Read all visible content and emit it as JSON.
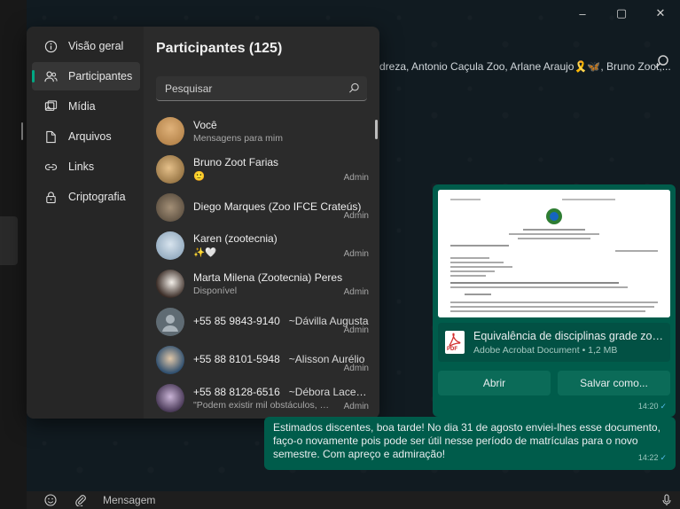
{
  "window": {
    "minimize": "–",
    "maximize": "▢",
    "close": "✕"
  },
  "chat": {
    "participants_line": "dreza, Antonio Caçula Zoo, Arlane Araujo🎗️🦋, Bruno Zoot,..."
  },
  "info_panel": {
    "nav": [
      {
        "label": "Visão geral",
        "icon": "info-icon"
      },
      {
        "label": "Participantes",
        "icon": "people-icon",
        "active": true
      },
      {
        "label": "Mídia",
        "icon": "image-icon"
      },
      {
        "label": "Arquivos",
        "icon": "file-icon"
      },
      {
        "label": "Links",
        "icon": "link-icon"
      },
      {
        "label": "Criptografia",
        "icon": "lock-icon"
      }
    ],
    "title": "Participantes (125)",
    "search_placeholder": "Pesquisar",
    "participants": [
      {
        "name": "Você",
        "status": "Mensagens para mim",
        "badge": "",
        "avatar_color": "#c99a63"
      },
      {
        "name": "Bruno Zoot Farias",
        "status": "🙂",
        "badge": "Admin",
        "avatar_color": "#b5894a"
      },
      {
        "name": "Diego Marques (Zoo IFCE Crateús)",
        "status": "",
        "badge": "Admin",
        "avatar_color": "#7a6a55"
      },
      {
        "name": "Karen (zootecnia)",
        "status": "✨🤍",
        "badge": "Admin",
        "avatar_color": "#9bb4c8"
      },
      {
        "name": "Marta Milena (Zootecnia) Peres",
        "status": "Disponível",
        "badge": "Admin",
        "avatar_color": "#5a4a42"
      },
      {
        "name": "+55 85 9843-9140",
        "alias": "~Dávilla Augusta",
        "status": "",
        "badge": "Admin",
        "avatar_color": "#5f6b73"
      },
      {
        "name": "+55 88 8101-5948",
        "alias": "~Alisson Aurélio",
        "status": "",
        "badge": "Admin",
        "avatar_color": "#4b6f8f"
      },
      {
        "name": "+55 88 8128-6516",
        "alias": "~Débora Lacerda...",
        "status": "\"Podem existir mil obstáculos, ma...",
        "badge": "Admin",
        "avatar_color": "#6d5a7a"
      }
    ]
  },
  "doc_message": {
    "file_name": "Equivalência de disciplinas grade zoot_...",
    "file_meta": "Adobe Acrobat Document • 1,2 MB",
    "open_label": "Abrir",
    "save_label": "Salvar como...",
    "time": "14:20"
  },
  "text_message": {
    "text": "Estimados discentes, boa tarde! No dia 31 de agosto enviei-lhes esse documento, faço-o novamente pois pode ser útil nesse período de matrículas para o novo semestre. Com apreço e admiração!",
    "time": "14:22"
  },
  "composer": {
    "placeholder": "Mensagem"
  }
}
